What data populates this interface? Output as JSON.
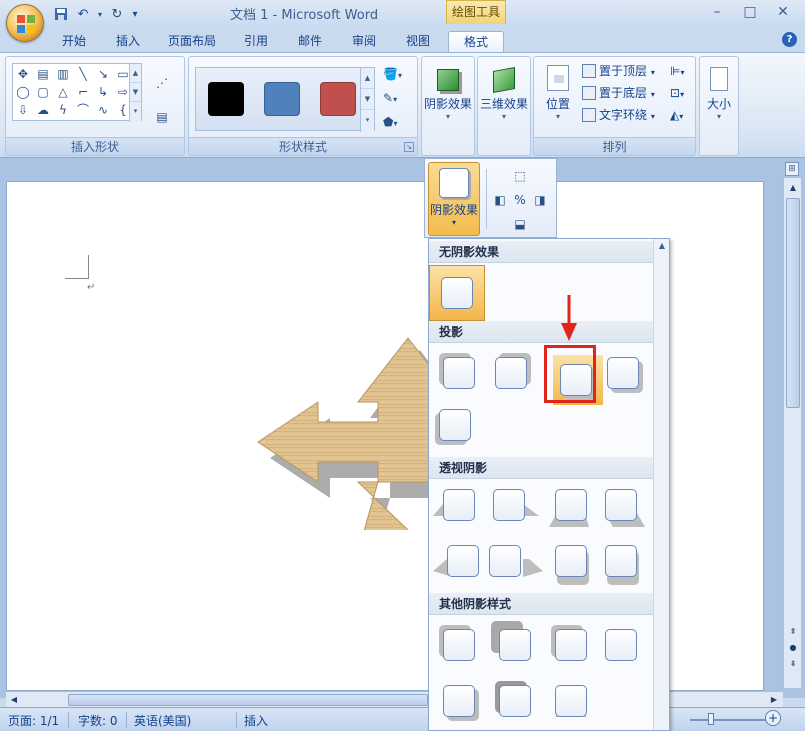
{
  "window": {
    "title": "文档 1 - Microsoft Word",
    "tools_label": "绘图工具"
  },
  "tabs": [
    {
      "label": "开始"
    },
    {
      "label": "插入"
    },
    {
      "label": "页面布局"
    },
    {
      "label": "引用"
    },
    {
      "label": "邮件"
    },
    {
      "label": "审阅"
    },
    {
      "label": "视图"
    },
    {
      "label": "格式"
    }
  ],
  "ribbon": {
    "insert_shapes_label": "插入形状",
    "shape_styles_label": "形状样式",
    "arrange_label": "排列",
    "shadow_effects": "阴影效果",
    "threed_effects": "三维效果",
    "position": "位置",
    "bring_front": "置于顶层",
    "send_back": "置于底层",
    "text_wrap": "文字环绕",
    "size": "大小",
    "style_colors": [
      "#000000",
      "#4f81bd",
      "#c0504d"
    ]
  },
  "shadow_menu": {
    "button_label": "阴影效果",
    "sections": {
      "none": "无阴影效果",
      "drop": "投影",
      "perspective": "透视阴影",
      "other": "其他阴影样式"
    }
  },
  "status": {
    "page": "页面: 1/1",
    "words": "字数: 0",
    "language": "英语(美国)",
    "mode": "插入"
  },
  "colors": {
    "highlight": "#e0241a",
    "hover": "#f4b64a",
    "shape_fill": "#e3c594"
  }
}
